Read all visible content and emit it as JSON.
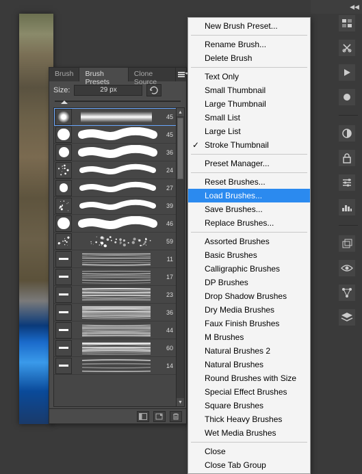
{
  "panel": {
    "tabs": [
      "Brush",
      "Brush Presets",
      "Clone Source"
    ],
    "active_tab_index": 1,
    "size_label": "Size:",
    "size_value": "29 px",
    "slider_pos_percent": 5
  },
  "brushes": [
    {
      "tip": "soft-round",
      "size": 45,
      "stroke": "soft-thick",
      "selected": true
    },
    {
      "tip": "hard-round",
      "size": 45,
      "stroke": "wavy-thick"
    },
    {
      "tip": "hard-round",
      "size": 36,
      "stroke": "wavy-thick"
    },
    {
      "tip": "scatter",
      "size": 24,
      "stroke": "wavy-medium"
    },
    {
      "tip": "hard-round",
      "size": 27,
      "stroke": "wavy-medium"
    },
    {
      "tip": "scatter",
      "size": 39,
      "stroke": "wavy-medium"
    },
    {
      "tip": "hard-round",
      "size": 46,
      "stroke": "wavy-thick"
    },
    {
      "tip": "scatter",
      "size": 59,
      "stroke": "texture-splat"
    },
    {
      "tip": "flat",
      "size": 11,
      "stroke": "streak-dry"
    },
    {
      "tip": "flat",
      "size": 17,
      "stroke": "streak-dry"
    },
    {
      "tip": "flat",
      "size": 23,
      "stroke": "streak-rough"
    },
    {
      "tip": "flat",
      "size": 36,
      "stroke": "streak-rough"
    },
    {
      "tip": "flat",
      "size": 44,
      "stroke": "streak-rough"
    },
    {
      "tip": "flat",
      "size": 60,
      "stroke": "streak-rough"
    },
    {
      "tip": "flat",
      "size": 14,
      "stroke": "streak-thin"
    }
  ],
  "menu": {
    "groups": [
      [
        {
          "label": "New Brush Preset..."
        }
      ],
      [
        {
          "label": "Rename Brush..."
        },
        {
          "label": "Delete Brush"
        }
      ],
      [
        {
          "label": "Text Only"
        },
        {
          "label": "Small Thumbnail"
        },
        {
          "label": "Large Thumbnail"
        },
        {
          "label": "Small List"
        },
        {
          "label": "Large List"
        },
        {
          "label": "Stroke Thumbnail",
          "checked": true
        }
      ],
      [
        {
          "label": "Preset Manager..."
        }
      ],
      [
        {
          "label": "Reset Brushes..."
        },
        {
          "label": "Load Brushes...",
          "highlight": true
        },
        {
          "label": "Save Brushes..."
        },
        {
          "label": "Replace Brushes..."
        }
      ],
      [
        {
          "label": "Assorted Brushes"
        },
        {
          "label": "Basic Brushes"
        },
        {
          "label": "Calligraphic Brushes"
        },
        {
          "label": "DP Brushes"
        },
        {
          "label": "Drop Shadow Brushes"
        },
        {
          "label": "Dry Media Brushes"
        },
        {
          "label": "Faux Finish Brushes"
        },
        {
          "label": "M Brushes"
        },
        {
          "label": "Natural Brushes 2"
        },
        {
          "label": "Natural Brushes"
        },
        {
          "label": "Round Brushes with Size"
        },
        {
          "label": "Special Effect Brushes"
        },
        {
          "label": "Square Brushes"
        },
        {
          "label": "Thick Heavy Brushes"
        },
        {
          "label": "Wet Media Brushes"
        }
      ],
      [
        {
          "label": "Close"
        },
        {
          "label": "Close Tab Group"
        }
      ]
    ]
  },
  "dock_icons": [
    "swatches-icon",
    "scissors-icon",
    "play-icon",
    "record-icon",
    "circle-contrast-icon",
    "lock-icon",
    "adjustments-icon",
    "histogram-icon",
    "layers-fx-icon",
    "eye-icon",
    "paths-icon",
    "layers-icon"
  ]
}
